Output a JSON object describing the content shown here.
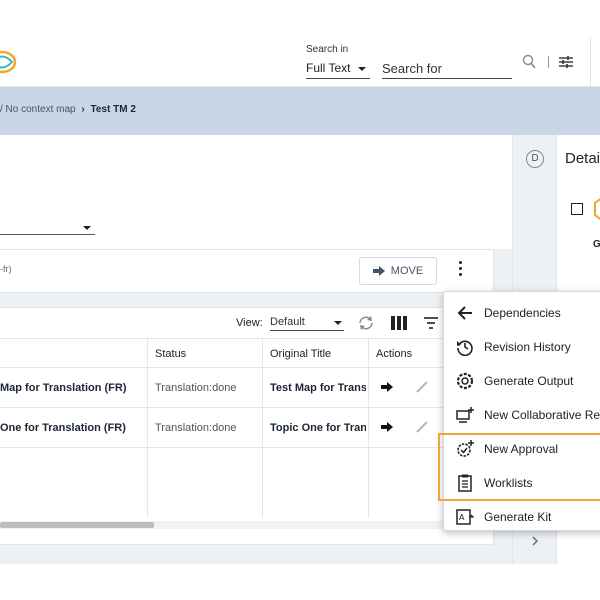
{
  "header": {
    "search_in_label": "Search in",
    "search_scope": "Full Text",
    "search_placeholder": "Search for"
  },
  "breadcrumb": {
    "path": "/ No context map",
    "current": "Test TM 2"
  },
  "toolbar": {
    "language_fragment": "-fr)",
    "move_label": "MOVE"
  },
  "table": {
    "view_label": "View:",
    "view_value": "Default",
    "columns": [
      "Status",
      "Original Title",
      "Actions"
    ],
    "rows": [
      {
        "title": "Map for Translation (FR)",
        "status": "Translation:done",
        "original_title": "Test Map for Translation"
      },
      {
        "title": "One for Translation (FR)",
        "status": "Translation:done",
        "original_title": "Topic One for Translation"
      }
    ]
  },
  "details": {
    "badge": "D",
    "title": "Details",
    "group_letter": "G"
  },
  "menu": {
    "items": [
      {
        "label": "Dependencies",
        "icon": "arrow-left-icon"
      },
      {
        "label": "Revision History",
        "icon": "history-icon"
      },
      {
        "label": "Generate Output",
        "icon": "gear-output-icon"
      },
      {
        "label": "New Collaborative Review",
        "icon": "collab-review-icon"
      },
      {
        "label": "New Approval",
        "icon": "approval-icon"
      },
      {
        "label": "Worklists",
        "icon": "clipboard-icon"
      },
      {
        "label": "Generate Kit",
        "icon": "translate-kit-icon"
      }
    ]
  },
  "colors": {
    "breadcrumb_bg": "#c8d6e5",
    "highlight": "#f0a33c",
    "accent": "#44546a",
    "logo": "#f5a623"
  }
}
